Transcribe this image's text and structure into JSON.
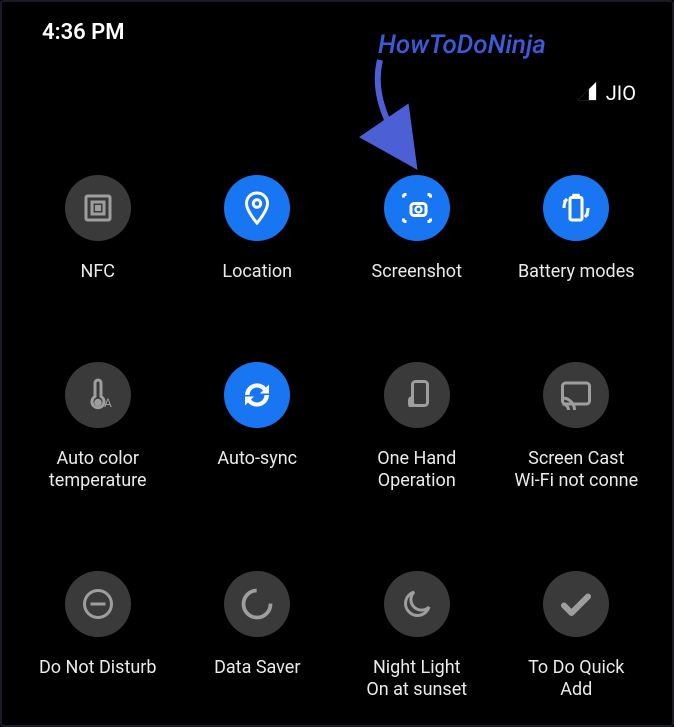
{
  "status": {
    "time": "4:36 PM",
    "network": "JIO"
  },
  "annotation": {
    "text": "HowToDoNinja"
  },
  "tiles": [
    {
      "name": "nfc",
      "label": "NFC",
      "state": "off",
      "icon": "nfc-icon"
    },
    {
      "name": "location",
      "label": "Location",
      "state": "on",
      "icon": "location-icon"
    },
    {
      "name": "screenshot",
      "label": "Screenshot",
      "state": "on",
      "icon": "screenshot-icon"
    },
    {
      "name": "battery-modes",
      "label": "Battery modes",
      "state": "on",
      "icon": "battery-icon"
    },
    {
      "name": "auto-color-temperature",
      "label": "Auto color\ntemperature",
      "state": "off",
      "icon": "temperature-icon"
    },
    {
      "name": "auto-sync",
      "label": "Auto-sync",
      "state": "on",
      "icon": "sync-icon"
    },
    {
      "name": "one-hand",
      "label": "One Hand\nOperation",
      "state": "off",
      "icon": "onehand-icon"
    },
    {
      "name": "screen-cast",
      "label": "Screen Cast\nWi-Fi not conne",
      "state": "off",
      "icon": "cast-icon"
    },
    {
      "name": "do-not-disturb",
      "label": "Do Not Disturb",
      "state": "off",
      "icon": "dnd-icon"
    },
    {
      "name": "data-saver",
      "label": "Data Saver",
      "state": "off",
      "icon": "datasaver-icon"
    },
    {
      "name": "night-light",
      "label": "Night Light\nOn at sunset",
      "state": "off",
      "icon": "nightlight-icon"
    },
    {
      "name": "todo-quick-add",
      "label": "To Do Quick\nAdd",
      "state": "off",
      "icon": "check-icon"
    }
  ]
}
